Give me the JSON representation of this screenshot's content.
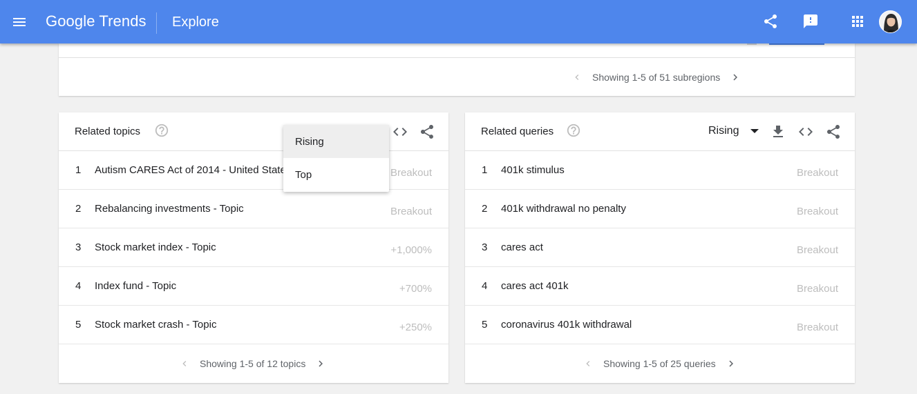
{
  "header": {
    "logo_google": "Google",
    "logo_trends": "Trends",
    "page_title": "Explore",
    "colors": {
      "appbar": "#4e86ec"
    },
    "icons": [
      "menu-icon",
      "share-icon",
      "feedback-icon",
      "apps-icon",
      "avatar"
    ]
  },
  "subregions": {
    "pager_text": "Showing 1-5 of 51 subregions"
  },
  "related_topics": {
    "title": "Related topics",
    "dropdown": {
      "selected": "Rising",
      "options": [
        "Rising",
        "Top"
      ]
    },
    "rows": [
      {
        "rank": "1",
        "label": "Autism CARES Act of 2014 - United States",
        "value": "Breakout"
      },
      {
        "rank": "2",
        "label": "Rebalancing investments - Topic",
        "value": "Breakout"
      },
      {
        "rank": "3",
        "label": "Stock market index - Topic",
        "value": "+1,000%"
      },
      {
        "rank": "4",
        "label": "Index fund - Topic",
        "value": "+700%"
      },
      {
        "rank": "5",
        "label": "Stock market crash - Topic",
        "value": "+250%"
      }
    ],
    "pager_text": "Showing 1-5 of 12 topics"
  },
  "related_queries": {
    "title": "Related queries",
    "selected": "Rising",
    "rows": [
      {
        "rank": "1",
        "label": "401k stimulus",
        "value": "Breakout"
      },
      {
        "rank": "2",
        "label": "401k withdrawal no penalty",
        "value": "Breakout"
      },
      {
        "rank": "3",
        "label": "cares act",
        "value": "Breakout"
      },
      {
        "rank": "4",
        "label": "cares act 401k",
        "value": "Breakout"
      },
      {
        "rank": "5",
        "label": "coronavirus 401k withdrawal",
        "value": "Breakout"
      }
    ],
    "pager_text": "Showing 1-5 of 25 queries"
  }
}
